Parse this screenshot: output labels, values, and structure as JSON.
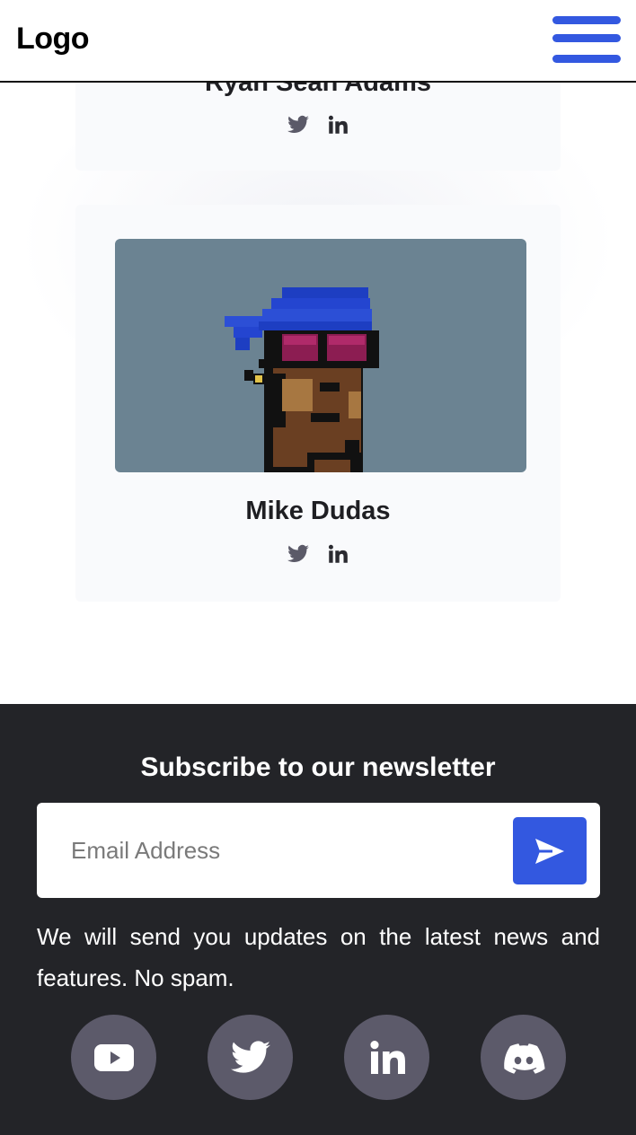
{
  "header": {
    "logo": "Logo"
  },
  "team": [
    {
      "name": "Ryan Sean Adams",
      "social": [
        "twitter-icon",
        "linkedin-icon"
      ]
    },
    {
      "name": "Mike Dudas",
      "social": [
        "twitter-icon",
        "linkedin-icon"
      ]
    }
  ],
  "newsletter": {
    "title": "Subscribe to our newsletter",
    "email_placeholder": "Email Address",
    "note": "We will send you updates on the latest news and features. No spam."
  },
  "footer_social": [
    "youtube-icon",
    "twitter-icon",
    "linkedin-icon",
    "discord-icon"
  ],
  "colors": {
    "accent": "#3358e0",
    "footer_bg": "#232428",
    "social_circle": "#5c5a6a",
    "card_bg": "#f9fafc",
    "avatar_bg": "#6b8392"
  }
}
